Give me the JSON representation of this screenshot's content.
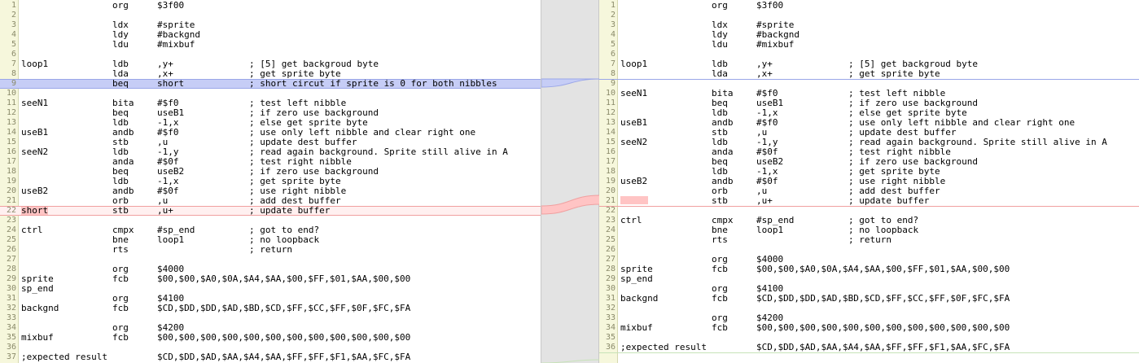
{
  "colors": {
    "change": "#c6cdf6",
    "delete": "#ffc4c4",
    "gutter": "#f6f7dc",
    "divider": "#e3e3e3"
  },
  "left": {
    "lines": [
      [
        "",
        "org",
        "$3f00",
        ""
      ],
      [
        "",
        "",
        "",
        ""
      ],
      [
        "",
        "ldx",
        "#sprite",
        ""
      ],
      [
        "",
        "ldy",
        "#backgnd",
        ""
      ],
      [
        "",
        "ldu",
        "#mixbuf",
        ""
      ],
      [
        "",
        "",
        "",
        ""
      ],
      [
        "loop1",
        "ldb",
        ",y+",
        "; [5] get backgroud byte"
      ],
      [
        "",
        "lda",
        ",x+",
        "; get sprite byte"
      ],
      [
        "",
        "beq",
        "short",
        "; short circut if sprite is 0 for both nibbles"
      ],
      [
        "",
        "",
        "",
        ""
      ],
      [
        "seeN1",
        "bita",
        "#$f0",
        "; test left nibble"
      ],
      [
        "",
        "beq",
        "useB1",
        "; if zero use background"
      ],
      [
        "",
        "ldb",
        "-1,x",
        "; else get sprite byte"
      ],
      [
        "useB1",
        "andb",
        "#$f0",
        "; use only left nibble and clear right one"
      ],
      [
        "",
        "stb",
        ",u",
        "; update dest buffer"
      ],
      [
        "seeN2",
        "ldb",
        "-1,y",
        "; read again background. Sprite still alive in A"
      ],
      [
        "",
        "anda",
        "#$0f",
        "; test right nibble"
      ],
      [
        "",
        "beq",
        "useB2",
        "; if zero use background"
      ],
      [
        "",
        "ldb",
        "-1,x",
        "; get sprite byte"
      ],
      [
        "useB2",
        "andb",
        "#$0f",
        "; use right nibble"
      ],
      [
        "",
        "orb",
        ",u",
        "; add dest buffer"
      ],
      [
        "short",
        "stb",
        ",u+",
        "; update buffer"
      ],
      [
        "",
        "",
        "",
        ""
      ],
      [
        "ctrl",
        "cmpx",
        "#sp_end",
        "; got to end?"
      ],
      [
        "",
        "bne",
        "loop1",
        "; no loopback"
      ],
      [
        "",
        "rts",
        "",
        "; return"
      ],
      [
        "",
        "",
        "",
        ""
      ],
      [
        "",
        "org",
        "$4000",
        ""
      ],
      [
        "sprite",
        "fcb",
        "$00,$00,$A0,$0A,$A4,$AA,$00,$FF,$01,$AA,$00,$00",
        ""
      ],
      [
        "sp_end",
        "",
        "",
        ""
      ],
      [
        "",
        "org",
        "$4100",
        ""
      ],
      [
        "backgnd",
        "fcb",
        "$CD,$DD,$DD,$AD,$BD,$CD,$FF,$CC,$FF,$0F,$FC,$FA",
        ""
      ],
      [
        "",
        "",
        "",
        ""
      ],
      [
        "",
        "org",
        "$4200",
        ""
      ],
      [
        "mixbuf",
        "fcb",
        "$00,$00,$00,$00,$00,$00,$00,$00,$00,$00,$00,$00",
        ""
      ],
      [
        "",
        "",
        "",
        ""
      ],
      [
        ";expected result",
        "",
        "$CD,$DD,$AD,$AA,$A4,$AA,$FF,$FF,$F1,$AA,$FC,$FA",
        ""
      ]
    ]
  },
  "right": {
    "lines": [
      [
        "",
        "org",
        "$3f00",
        ""
      ],
      [
        "",
        "",
        "",
        ""
      ],
      [
        "",
        "ldx",
        "#sprite",
        ""
      ],
      [
        "",
        "ldy",
        "#backgnd",
        ""
      ],
      [
        "",
        "ldu",
        "#mixbuf",
        ""
      ],
      [
        "",
        "",
        "",
        ""
      ],
      [
        "loop1",
        "ldb",
        ",y+",
        "; [5] get backgroud byte"
      ],
      [
        "",
        "lda",
        ",x+",
        "; get sprite byte"
      ],
      [
        "",
        "",
        "",
        ""
      ],
      [
        "seeN1",
        "bita",
        "#$f0",
        "; test left nibble"
      ],
      [
        "",
        "beq",
        "useB1",
        "; if zero use background"
      ],
      [
        "",
        "ldb",
        "-1,x",
        "; else get sprite byte"
      ],
      [
        "useB1",
        "andb",
        "#$f0",
        "; use only left nibble and clear right one"
      ],
      [
        "",
        "stb",
        ",u",
        "; update dest buffer"
      ],
      [
        "seeN2",
        "ldb",
        "-1,y",
        "; read again background. Sprite still alive in A"
      ],
      [
        "",
        "anda",
        "#$0f",
        "; test right nibble"
      ],
      [
        "",
        "beq",
        "useB2",
        "; if zero use background"
      ],
      [
        "",
        "ldb",
        "-1,x",
        "; get sprite byte"
      ],
      [
        "useB2",
        "andb",
        "#$0f",
        "; use right nibble"
      ],
      [
        "",
        "orb",
        ",u",
        "; add dest buffer"
      ],
      [
        "",
        "stb",
        ",u+",
        "; update buffer"
      ],
      [
        "",
        "",
        "",
        ""
      ],
      [
        "ctrl",
        "cmpx",
        "#sp_end",
        "; got to end?"
      ],
      [
        "",
        "bne",
        "loop1",
        "; no loopback"
      ],
      [
        "",
        "rts",
        "",
        "; return"
      ],
      [
        "",
        "",
        "",
        ""
      ],
      [
        "",
        "org",
        "$4000",
        ""
      ],
      [
        "sprite",
        "fcb",
        "$00,$00,$A0,$0A,$A4,$AA,$00,$FF,$01,$AA,$00,$00",
        ""
      ],
      [
        "sp_end",
        "",
        "",
        ""
      ],
      [
        "",
        "org",
        "$4100",
        ""
      ],
      [
        "backgnd",
        "fcb",
        "$CD,$DD,$DD,$AD,$BD,$CD,$FF,$CC,$FF,$0F,$FC,$FA",
        ""
      ],
      [
        "",
        "",
        "",
        ""
      ],
      [
        "",
        "org",
        "$4200",
        ""
      ],
      [
        "mixbuf",
        "fcb",
        "$00,$00,$00,$00,$00,$00,$00,$00,$00,$00,$00,$00",
        ""
      ],
      [
        "",
        "",
        "",
        ""
      ],
      [
        ";expected result",
        "",
        "$CD,$DD,$AD,$AA,$A4,$AA,$FF,$FF,$F1,$AA,$FC,$FA",
        ""
      ]
    ]
  }
}
